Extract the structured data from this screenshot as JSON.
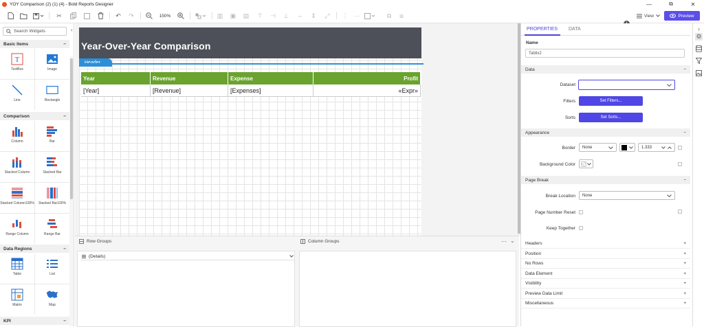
{
  "window": {
    "title": "YOY Comparison (2) (1) (4) - Bold Reports Designer",
    "min": "—",
    "max": "⧉",
    "close": "✕"
  },
  "toolbar": {
    "zoom": "150%",
    "view_label": "View",
    "preview_label": "Preview",
    "info": "i"
  },
  "left": {
    "search_placeholder": "Search Widgets",
    "sections": [
      {
        "label": "Basic Items",
        "toggle": "−"
      },
      {
        "label": "Comparison",
        "toggle": "−"
      },
      {
        "label": "Data Regions",
        "toggle": "−"
      },
      {
        "label": "KPI",
        "toggle": "−"
      }
    ],
    "basic": [
      "TextBox",
      "Image",
      "Line",
      "Rectangle"
    ],
    "comparison": [
      "Column",
      "Bar",
      "Stacked Column",
      "Stacked Bar",
      "Stacked Column100%",
      "Stacked Bar100%",
      "Range Column",
      "Range Bar"
    ],
    "dataregions": [
      "Table",
      "List",
      "Matrix",
      "Map"
    ]
  },
  "report": {
    "title": "Year-Over-Year Comparison",
    "header_tag": "Header",
    "columns": [
      "Year",
      "Revenue",
      "Expense",
      "Profit"
    ],
    "cells": [
      "[Year]",
      "[Revenue]",
      "[Expenses]",
      "«Expr»"
    ],
    "header_color": "#4d5058",
    "table_header_color": "#6aa32e",
    "accent": "#2d8fd6"
  },
  "groups": {
    "row_label": "Row Groups",
    "column_label": "Column Groups",
    "details_label": "(Details)"
  },
  "properties": {
    "tabs": [
      "PROPERTIES",
      "DATA"
    ],
    "name_label": "Name",
    "name_value": "Tablix2",
    "data_section": "Data",
    "dataset_label": "Dataset",
    "dataset_value": "",
    "filters_label": "Filters",
    "filters_button": "Set Filters...",
    "sorts_label": "Sorts",
    "sorts_button": "Set Sorts...",
    "appearance_section": "Appearance",
    "border_label": "Border",
    "border_style": "None",
    "border_width": "1.333",
    "bgcolor_label": "Background Color",
    "pagebreak_section": "Page Break",
    "break_location_label": "Break Location",
    "break_location_value": "None",
    "page_number_reset_label": "Page Number Reset",
    "keep_together_label": "Keep Together",
    "collapsed": [
      "Headers",
      "Position",
      "No Rows",
      "Data Element",
      "Visibility",
      "Preview Data Limit",
      "Miscellaneous"
    ],
    "plus": "+",
    "minus": "−",
    "accent": "#4f46e5"
  }
}
